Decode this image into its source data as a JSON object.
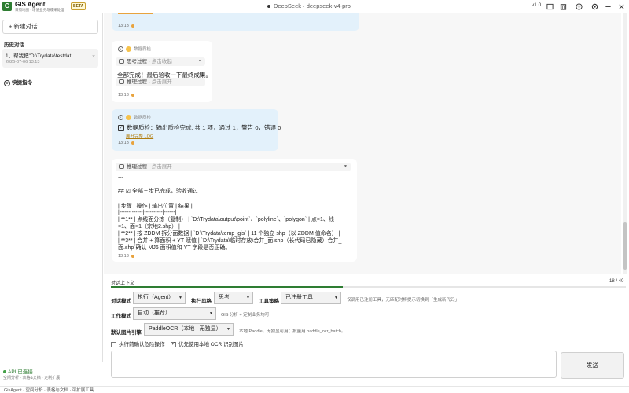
{
  "app": {
    "logo_letter": "G",
    "name": "GIS Agent",
    "subtitle": "日照地图 · 增值业务与成果处理",
    "badge": "BETA",
    "model_title": "DeepSeek · deepseek-v4-pro",
    "version": "v1.0"
  },
  "titlebar_icons": [
    "book-icon",
    "building-icon",
    "palette-icon",
    "settings-icon",
    "minimize-icon",
    "close-icon"
  ],
  "sidebar": {
    "new_chat": "+ 新建对话",
    "history_title": "历史对话",
    "history_items": [
      {
        "title": "1、帮我把\"D:\\Trydata\\testdat...",
        "date": "2026-07-06 13:13",
        "close": "×"
      }
    ],
    "quick_title": "快捷指令",
    "api_status": "API 已连接",
    "api_sub": "空间分析 · 表格&文档 · 定制扩展"
  },
  "chat": {
    "msg1": {
      "time": "13:13"
    },
    "msg2": {
      "tag": "数据质检",
      "thinking": "思考过程",
      "thinking_hint": "· 点击收起",
      "text": "全部完成！最后验收一下最终成果。",
      "reasoning": "推理过程",
      "reasoning_hint": "· 点击展开",
      "time": "13:13"
    },
    "msg3": {
      "time_top": "13:13",
      "tag": "数据质检",
      "text": "数据质检：输出质检完成: 共 1 项，通过 1，警告 0，错误 0",
      "log_link": "展开完整 LOG",
      "time": "13:13"
    },
    "msg4": {
      "reasoning": "推理过程",
      "reasoning_hint": "· 点击展开",
      "lines": [
        "---",
        "## ☑ 全部三步已完成，验收通过",
        "| 步骤 | 操作 | 输出位置 | 结果 |",
        "|------|------|----------|------|",
        "| **1** | 点线面分拣（复制） | `D:\\Trydata\\output\\point`、`polyline`、`polygon` | 点×1、线",
        "×1、面×1（宗地2.shp） |",
        "| **2** | 按 ZDDM 拆分面数据 | `D:\\Trydata\\temp_gis` | 11 个独立 shp（以 ZDDM 值命名） |",
        "| **3** | 合并 + 算面积 + YT 赋值 | `D:\\Trydata\\临时存放\\合并_面.shp（长代码已隐藏）合并_",
        "面.shp`确认 MJ6 面积值和 YT 字段是否正确。"
      ],
      "time": "13:13"
    }
  },
  "context": {
    "label": "对话上下文",
    "count": "18 / 40",
    "progress": 0.45
  },
  "controls": {
    "mode_label": "对话模式",
    "mode_value": "执行（Agent）",
    "style_label": "执行风格",
    "style_value": "思考",
    "tool_label": "工具策略",
    "tool_value": "已注册工具",
    "tool_hint": "仅调用已注册工具，无匹配时将提示切换到「生成新代码」",
    "work_label": "工作模式",
    "work_value": "自动（推荐）",
    "work_hint": "GIS 分析 + 定制业务均可",
    "ocr_label": "默认图片引擎",
    "ocr_value": "PaddleOCR（本地 · 无独显）",
    "ocr_hint": "本地 Paddle，无独显可用；批量用 paddle_ocr_batch。",
    "confirm_label": "执行前确认危险操作",
    "confirm_checked": false,
    "local_ocr_label": "优先使用本地 OCR 识别图片",
    "local_ocr_checked": true,
    "send": "发送"
  },
  "statusbar": {
    "text": "GisAgent · 空间分析 · 表格与文档 · 可扩展工具"
  },
  "colors": {
    "brand": "#2e7d32",
    "bubble_blue": "#e3f1fb",
    "accent_orange": "#e8a33d"
  }
}
